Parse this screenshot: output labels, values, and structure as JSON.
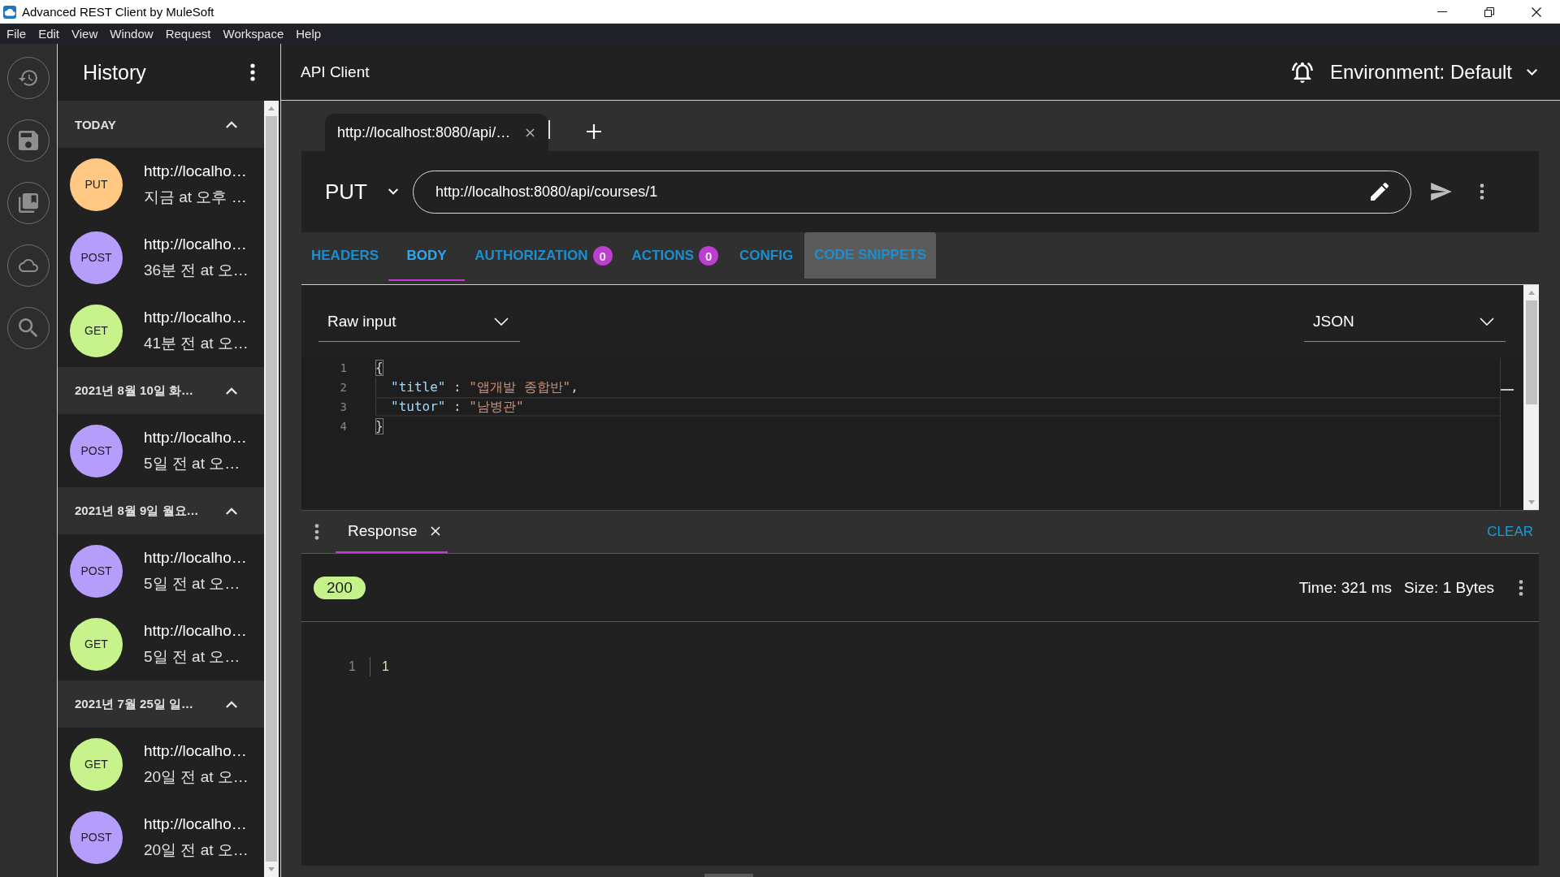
{
  "window": {
    "title": "Advanced REST Client by MuleSoft"
  },
  "menu": [
    "File",
    "Edit",
    "View",
    "Window",
    "Request",
    "Workspace",
    "Help"
  ],
  "history": {
    "title": "History",
    "groups": [
      {
        "label": "TODAY",
        "expanded": true,
        "items": [
          {
            "method": "PUT",
            "color": "#ffc984",
            "url": "http://localho…",
            "time": "지금 at 오후 …"
          },
          {
            "method": "POST",
            "color": "#b59dfc",
            "url": "http://localho…",
            "time": "36분 전 at 오…"
          },
          {
            "method": "GET",
            "color": "#c7f28c",
            "url": "http://localho…",
            "time": "41분 전 at 오…"
          }
        ]
      },
      {
        "label": "2021년 8월 10일 화…",
        "expanded": true,
        "items": [
          {
            "method": "POST",
            "color": "#b59dfc",
            "url": "http://localho…",
            "time": "5일 전 at 오…"
          }
        ]
      },
      {
        "label": "2021년 8월 9일 월요…",
        "expanded": true,
        "items": [
          {
            "method": "POST",
            "color": "#b59dfc",
            "url": "http://localho…",
            "time": "5일 전 at 오…"
          },
          {
            "method": "GET",
            "color": "#c7f28c",
            "url": "http://localho…",
            "time": "5일 전 at 오…"
          }
        ]
      },
      {
        "label": "2021년 7월 25일 일…",
        "expanded": true,
        "items": [
          {
            "method": "GET",
            "color": "#c7f28c",
            "url": "http://localho…",
            "time": "20일 전 at 오…"
          },
          {
            "method": "POST",
            "color": "#b59dfc",
            "url": "http://localho…",
            "time": "20일 전 at 오…"
          }
        ]
      }
    ]
  },
  "header": {
    "title": "API Client",
    "environment": "Environment: Default"
  },
  "request_tabs": [
    {
      "label": "http://localhost:8080/api/…",
      "selected": true
    }
  ],
  "request": {
    "method": "PUT",
    "url": "http://localhost:8080/api/courses/1"
  },
  "editor_tabs": [
    {
      "label": "HEADERS",
      "selected": false,
      "highlighted": false
    },
    {
      "label": "BODY",
      "selected": true,
      "highlighted": false
    },
    {
      "label": "AUTHORIZATION",
      "badge": "0",
      "selected": false,
      "highlighted": false
    },
    {
      "label": "ACTIONS",
      "badge": "0",
      "selected": false,
      "highlighted": false
    },
    {
      "label": "CONFIG",
      "selected": false,
      "highlighted": false
    },
    {
      "label": "CODE SNIPPETS",
      "selected": false,
      "highlighted": true
    }
  ],
  "body": {
    "input_type": "Raw input",
    "content_type": "JSON",
    "lines": [
      {
        "number": "1",
        "active": false,
        "tokens": [
          {
            "kind": "bracket",
            "text": "{"
          }
        ],
        "children": [
          {
            "number": "2",
            "active": false,
            "tokens": [
              {
                "kind": "key",
                "text": "\"title\""
              },
              {
                "kind": "punct",
                "text": " : "
              },
              {
                "kind": "string",
                "text": "\"앱개발 종합반\""
              },
              {
                "kind": "punct",
                "text": ","
              }
            ]
          },
          {
            "number": "3",
            "active": true,
            "tokens": [
              {
                "kind": "key",
                "text": "\"tutor\""
              },
              {
                "kind": "punct",
                "text": " : "
              },
              {
                "kind": "string",
                "text": "\"남병관\""
              }
            ]
          }
        ]
      },
      {
        "number": "4",
        "active": false,
        "tokens": [
          {
            "kind": "bracket",
            "text": "}"
          }
        ]
      }
    ]
  },
  "response": {
    "tab": {
      "label": "Response",
      "selected": true
    },
    "clear": "CLEAR",
    "status": "200",
    "time": "Time: 321 ms",
    "size": "Size: 1 Bytes",
    "lines": [
      {
        "number": "1",
        "text": "1"
      }
    ]
  }
}
